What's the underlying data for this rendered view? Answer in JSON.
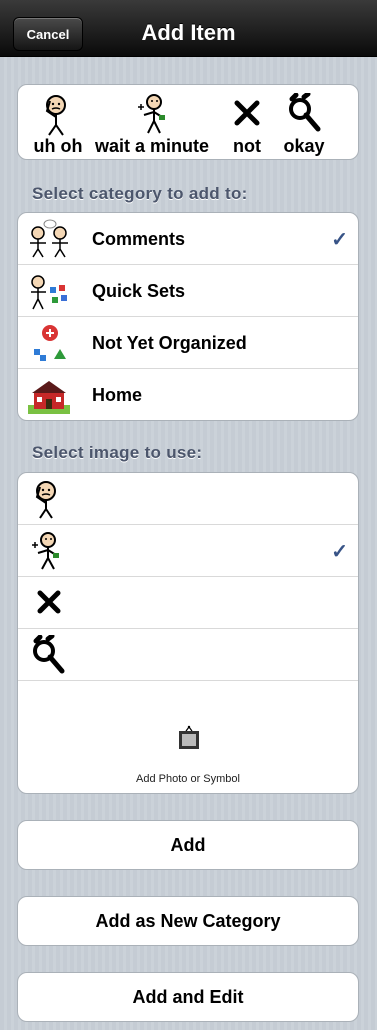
{
  "nav": {
    "cancel_label": "Cancel",
    "title": "Add Item"
  },
  "preview": {
    "words": [
      {
        "label": "uh oh",
        "icon": "puzzled-person-icon"
      },
      {
        "label": "wait a minute",
        "icon": "waiting-person-icon"
      },
      {
        "label": "not",
        "icon": "x-mark-icon"
      },
      {
        "label": "okay",
        "icon": "ok-hand-icon"
      }
    ]
  },
  "category_section": {
    "header": "Select category to add to:",
    "items": [
      {
        "label": "Comments",
        "icon": "comments-icon",
        "selected": true
      },
      {
        "label": "Quick Sets",
        "icon": "quick-sets-icon",
        "selected": false
      },
      {
        "label": "Not Yet Organized",
        "icon": "not-yet-organized-icon",
        "selected": false
      },
      {
        "label": "Home",
        "icon": "home-icon",
        "selected": false
      }
    ]
  },
  "image_section": {
    "header": "Select image to use:",
    "items": [
      {
        "icon": "puzzled-person-icon",
        "selected": false
      },
      {
        "icon": "waiting-person-icon",
        "selected": true
      },
      {
        "icon": "x-mark-icon",
        "selected": false
      },
      {
        "icon": "ok-hand-icon",
        "selected": false
      }
    ],
    "add_photo_label": "Add Photo or Symbol"
  },
  "actions": {
    "add": "Add",
    "add_new_category": "Add as New Category",
    "add_and_edit": "Add and Edit"
  },
  "colors": {
    "checkmark": "#385487",
    "section_header": "#4c566c",
    "nav_bar": "#1a1a1a"
  }
}
